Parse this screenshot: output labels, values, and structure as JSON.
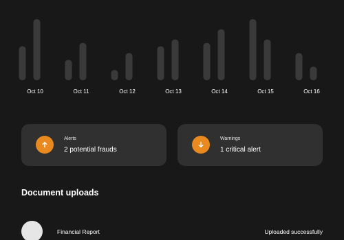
{
  "chart_data": {
    "type": "bar",
    "categories": [
      "Oct 10",
      "Oct 11",
      "Oct 12",
      "Oct 13",
      "Oct 14",
      "Oct 15",
      "Oct 16"
    ],
    "series": [
      {
        "values": [
          5,
          3,
          1.5,
          5,
          5.5,
          9,
          4
        ]
      },
      {
        "values": [
          9,
          5.5,
          4,
          6,
          7.5,
          6,
          2
        ]
      }
    ],
    "ylim": [
      0,
      9.5
    ],
    "grid": false,
    "color": "#3a3a3a"
  },
  "cards": {
    "alerts": {
      "title": "Alerts",
      "value": "2 potential frauds",
      "icon": "arrow-up-icon"
    },
    "warnings": {
      "title": "Warnings",
      "value": "1 critical alert",
      "icon": "arrow-down-icon"
    }
  },
  "uploads": {
    "title": "Document uploads",
    "items": [
      {
        "name": "Financial Report",
        "status": "Uploaded successfully"
      }
    ]
  },
  "colors": {
    "background": "#181818",
    "card": "#303030",
    "accent": "#e88a1f"
  }
}
